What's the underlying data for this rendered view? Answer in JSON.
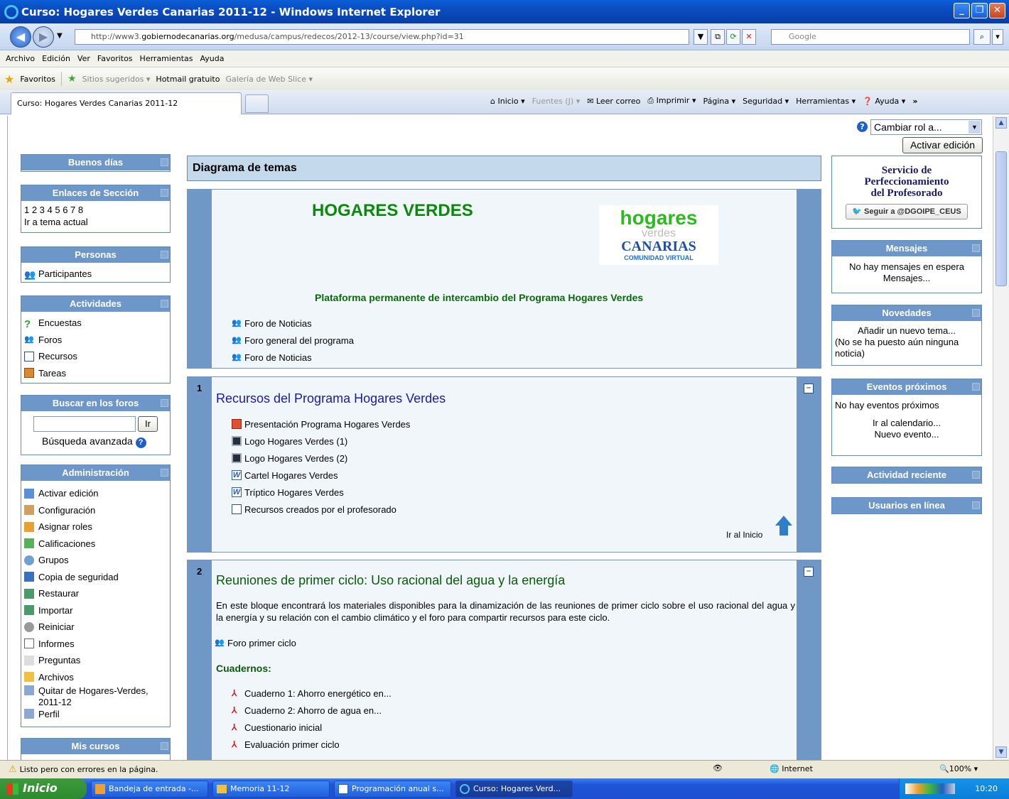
{
  "window": {
    "title": "Curso: Hogares Verdes Canarias 2011-12 - Windows Internet Explorer"
  },
  "address": {
    "url_host": "http://www3.",
    "url_domain": "gobiernodecanarias.org",
    "url_path": "/medusa/campus/redecos/2012-13/course/view.php?id=31",
    "search_placeholder": "Google"
  },
  "menubar": [
    "Archivo",
    "Edición",
    "Ver",
    "Favoritos",
    "Herramientas",
    "Ayuda"
  ],
  "favbar": {
    "favoritos": "Favoritos",
    "sitios": "Sitios sugeridos ▾",
    "hotmail": "Hotmail gratuito",
    "galeria": "Galería de Web Slice ▾"
  },
  "tab": {
    "label": "Curso: Hogares Verdes Canarias 2011-12"
  },
  "commands": {
    "inicio": "Inicio",
    "fuentes": "Fuentes (J)",
    "leer": "Leer correo",
    "imprimir": "Imprimir",
    "pagina": "Página ▾",
    "seguridad": "Seguridad ▾",
    "herramientas": "Herramientas ▾",
    "ayuda": "Ayuda ▾"
  },
  "topright": {
    "role_select": "Cambiar rol a...",
    "edit_button": "Activar edición"
  },
  "left": {
    "greeting": "Buenos días",
    "sections": {
      "title": "Enlaces de Sección",
      "numbers": "1 2 3 4 5 6 7 8",
      "current": "Ir a tema actual"
    },
    "people": {
      "title": "Personas",
      "item": "Participantes"
    },
    "activities": {
      "title": "Actividades",
      "items": [
        "Encuestas",
        "Foros",
        "Recursos",
        "Tareas"
      ]
    },
    "search": {
      "title": "Buscar en los foros",
      "button": "Ir",
      "advanced": "Búsqueda avanzada"
    },
    "admin": {
      "title": "Administración",
      "items": [
        "Activar edición",
        "Configuración",
        "Asignar roles",
        "Calificaciones",
        "Grupos",
        "Copia de seguridad",
        "Restaurar",
        "Importar",
        "Reiniciar",
        "Informes",
        "Preguntas",
        "Archivos",
        "Quitar de Hogares-Verdes,",
        "2011-12",
        "Perfil"
      ]
    },
    "mycourses": {
      "title": "Mis cursos"
    }
  },
  "middle": {
    "header": "Diagrama de temas",
    "section0": {
      "title": "HOGARES VERDES",
      "subtitle": "Plataforma permanente de intercambio del Programa Hogares Verdes",
      "logo_line1": "hogares",
      "logo_line2": "verdes",
      "logo_line3": "CANARIAS",
      "logo_line4": "COMUNIDAD VIRTUAL",
      "links": [
        "Foro de Noticias",
        "Foro general del programa",
        "Foro de Noticias"
      ]
    },
    "section1": {
      "num": "1",
      "title": "Recursos del Programa Hogares Verdes",
      "links": [
        "Presentación Programa Hogares Verdes",
        "Logo Hogares Verdes (1)",
        "Logo Hogares Verdes (2)",
        "Cartel Hogares Verdes",
        "Tríptico Hogares Verdes",
        "Recursos creados por el profesorado"
      ],
      "top_link": "Ir al Inicio"
    },
    "section2": {
      "num": "2",
      "title": "Reuniones de primer ciclo: Uso racional del agua y la energía",
      "text": "En este bloque encontrará los materiales disponibles para la dinamización de las reuniones de primer ciclo sobre el uso racional del agua y la energía y su relación con el cambio climático y el foro para compartir recursos para este ciclo.",
      "forum": "Foro primer ciclo",
      "subhead": "Cuadernos:",
      "docs": [
        "Cuaderno 1: Ahorro energético en...",
        "Cuaderno 2: Ahorro de agua en...",
        "Cuestionario inicial",
        "Evaluación primer ciclo"
      ]
    }
  },
  "right": {
    "service": {
      "line1": "Servicio de",
      "line2": "Perfeccionamiento",
      "line3": "del Profesorado",
      "follow": "Seguir a @DGOIPE_CEUS"
    },
    "messages": {
      "title": "Mensajes",
      "text": "No hay mensajes en espera",
      "link": "Mensajes..."
    },
    "news": {
      "title": "Novedades",
      "link": "Añadir un nuevo tema...",
      "text": "(No se ha puesto aún ninguna noticia)"
    },
    "events": {
      "title": "Eventos próximos",
      "text": "No hay eventos próximos",
      "calendar": "Ir al calendario...",
      "new": "Nuevo evento..."
    },
    "recent": {
      "title": "Actividad reciente"
    },
    "online": {
      "title": "Usuarios en línea"
    }
  },
  "status": {
    "text": "Listo pero con errores en la página.",
    "zone": "Internet",
    "zoom": "100%"
  },
  "taskbar": {
    "start": "Inicio",
    "tasks": [
      "Bandeja de entrada -...",
      "Memoria 11-12",
      "Programación anual s...",
      "Curso: Hogares Verd..."
    ],
    "clock": "10:20"
  }
}
